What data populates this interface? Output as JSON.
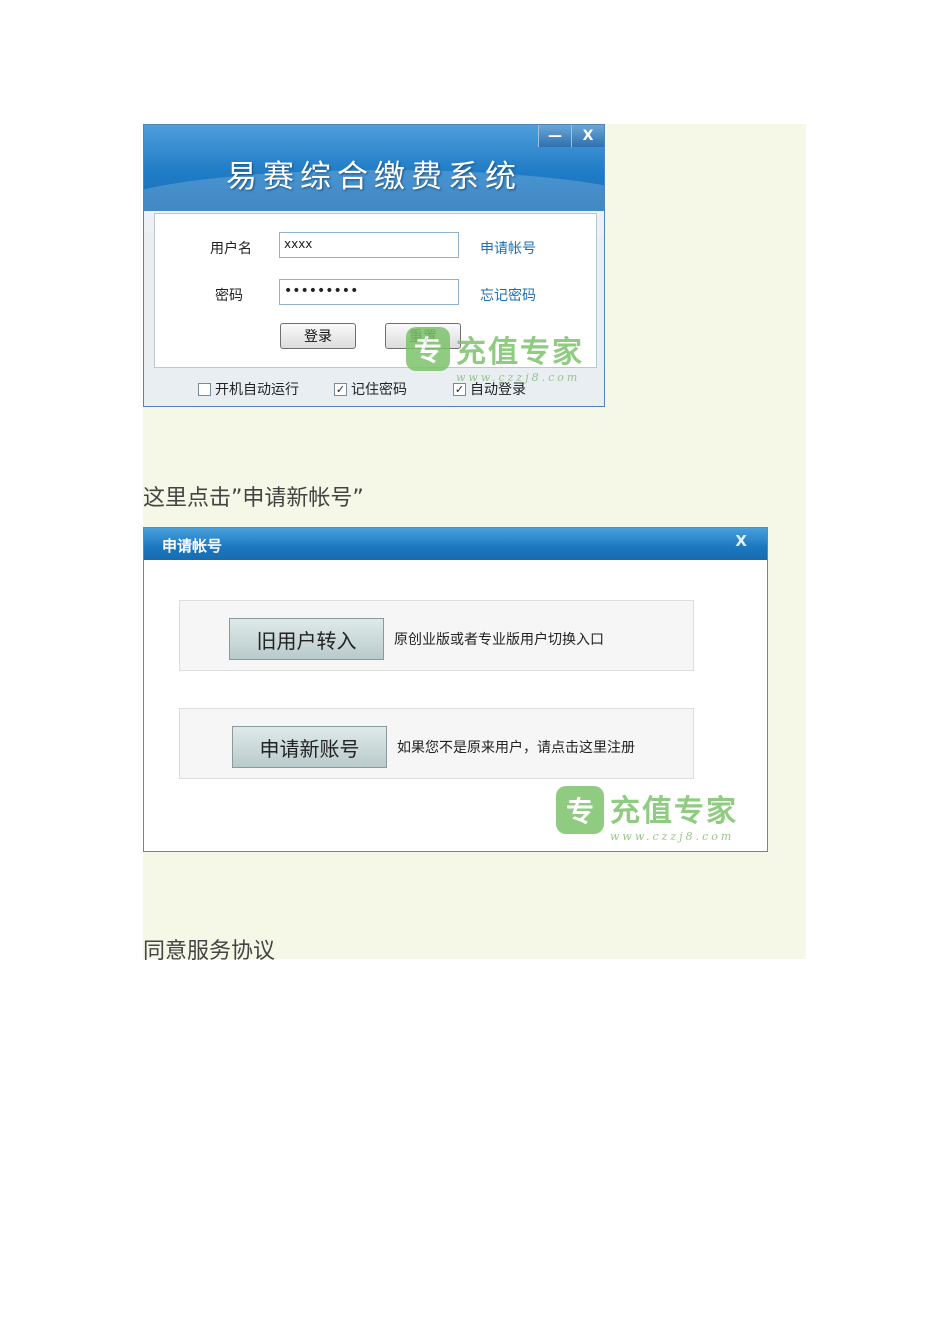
{
  "login_window": {
    "title": "易赛综合缴费系统",
    "minimize_label": "—",
    "close_label": "X",
    "username_label": "用户名",
    "username_value": "xxxx",
    "password_label": "密码",
    "password_value": "•••••••••",
    "apply_account_link": "申请帐号",
    "forgot_password_link": "忘记密码",
    "login_button": "登录",
    "reset_button": "重置",
    "checkboxes": [
      {
        "label": "开机自动运行",
        "checked": false
      },
      {
        "label": "记住密码",
        "checked": true
      },
      {
        "label": "自动登录",
        "checked": true
      }
    ]
  },
  "watermark": {
    "logo_glyph": "专",
    "text": "充值专家",
    "url": "www.czzj8.com"
  },
  "caption_1": "这里点击”申请新帐号”",
  "apply_dialog": {
    "title": "申请帐号",
    "close_label": "X",
    "options": [
      {
        "button": "旧用户转入",
        "description": "原创业版或者专业版用户切换入口"
      },
      {
        "button": "申请新账号",
        "description": "如果您不是原来用户，请点击这里注册"
      }
    ]
  },
  "caption_2": "同意服务协议",
  "colors": {
    "panel_bg": "#f5f8e6",
    "header_blue": "#1f7cc6",
    "link_blue": "#1b6fb5",
    "watermark_green": "#7cc36a"
  }
}
